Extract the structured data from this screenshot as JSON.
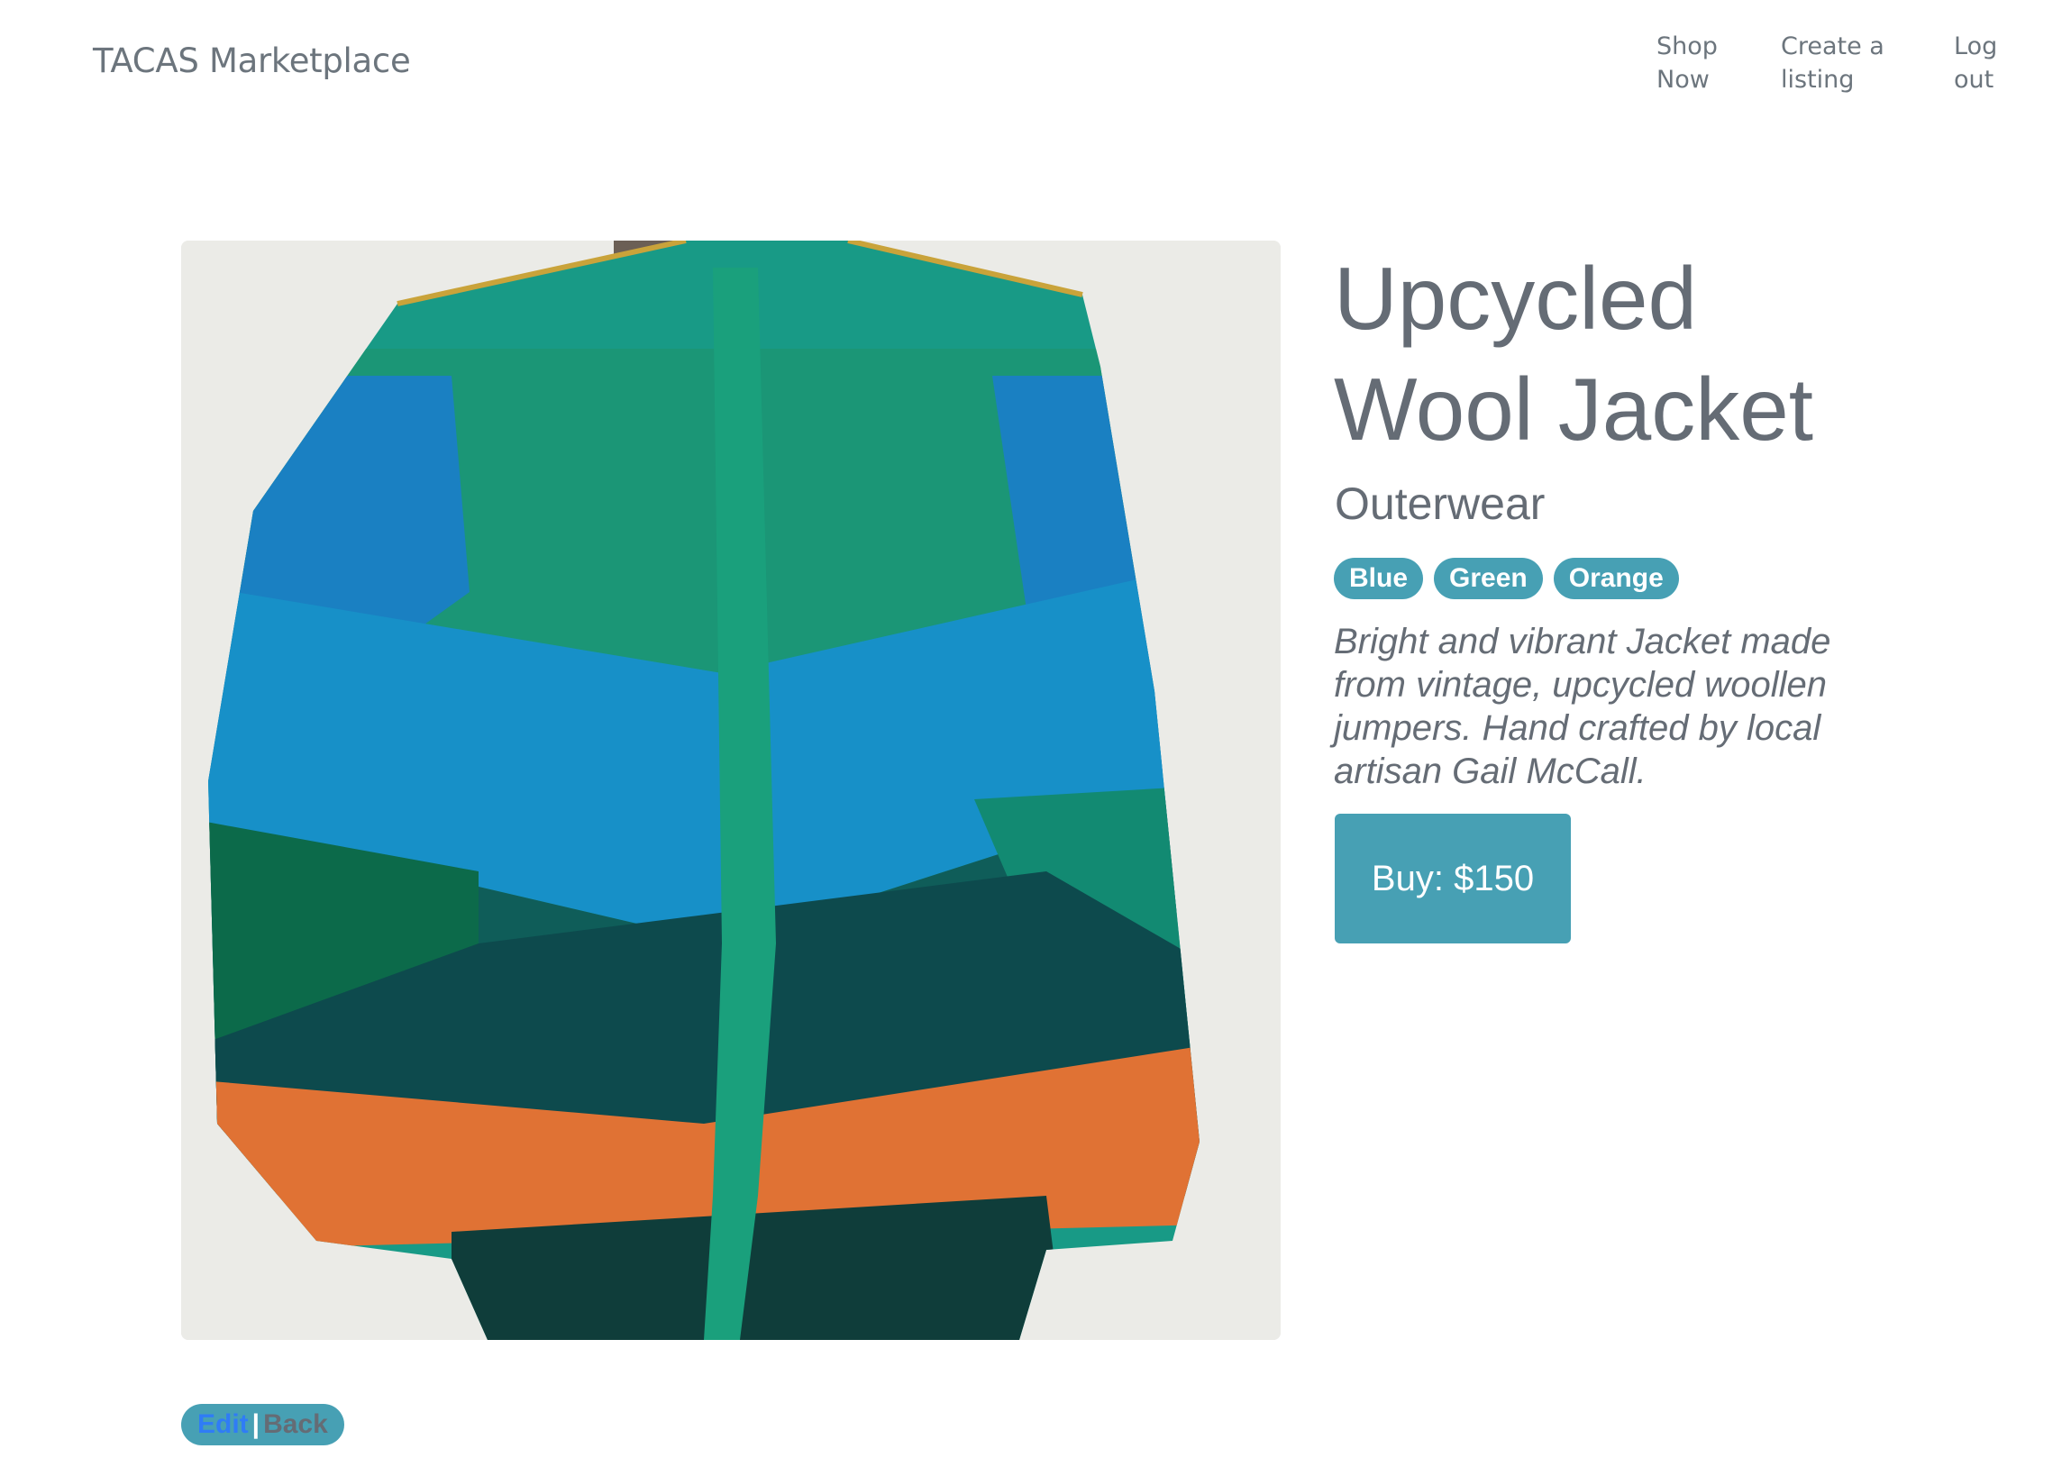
{
  "navbar": {
    "brand": "TACAS Marketplace",
    "links": [
      {
        "label": "Shop\nNow"
      },
      {
        "label": "Create a\nlisting"
      },
      {
        "label": "Log\nout"
      }
    ]
  },
  "product": {
    "title": "Upcycled Wool Jacket",
    "category": "Outerwear",
    "tags": [
      "Blue",
      "Green",
      "Orange"
    ],
    "description": "Bright and vibrant Jacket made from vintage, upcycled woollen jumpers. Hand crafted by local artisan Gail McCall.",
    "buy_label": "Buy: $150"
  },
  "actions": {
    "edit_label": "Edit",
    "separator": "|",
    "back_label": "Back"
  },
  "colors": {
    "accent": "#47a0b4",
    "text_muted": "#656c75",
    "link": "#2f7cf6"
  }
}
